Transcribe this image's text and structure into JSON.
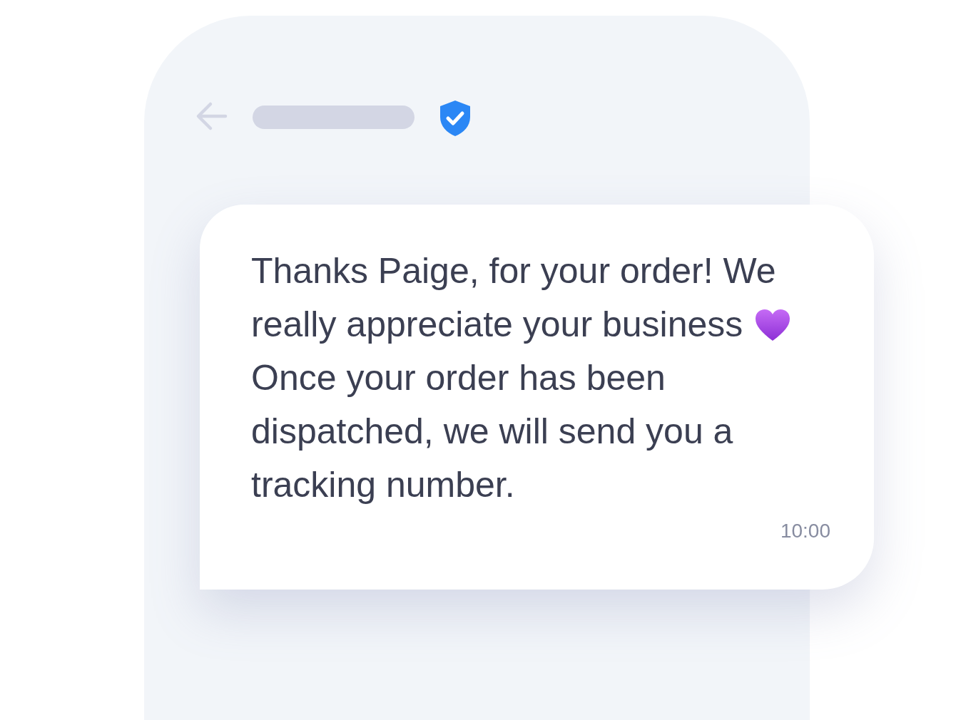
{
  "message": {
    "first_lines": [
      "Thanks Paige, for your order! We",
      "really appreciate your business"
    ],
    "text_continued": "Once your order has been dispatched, we will send you a tracking number.",
    "time": "10:00"
  }
}
